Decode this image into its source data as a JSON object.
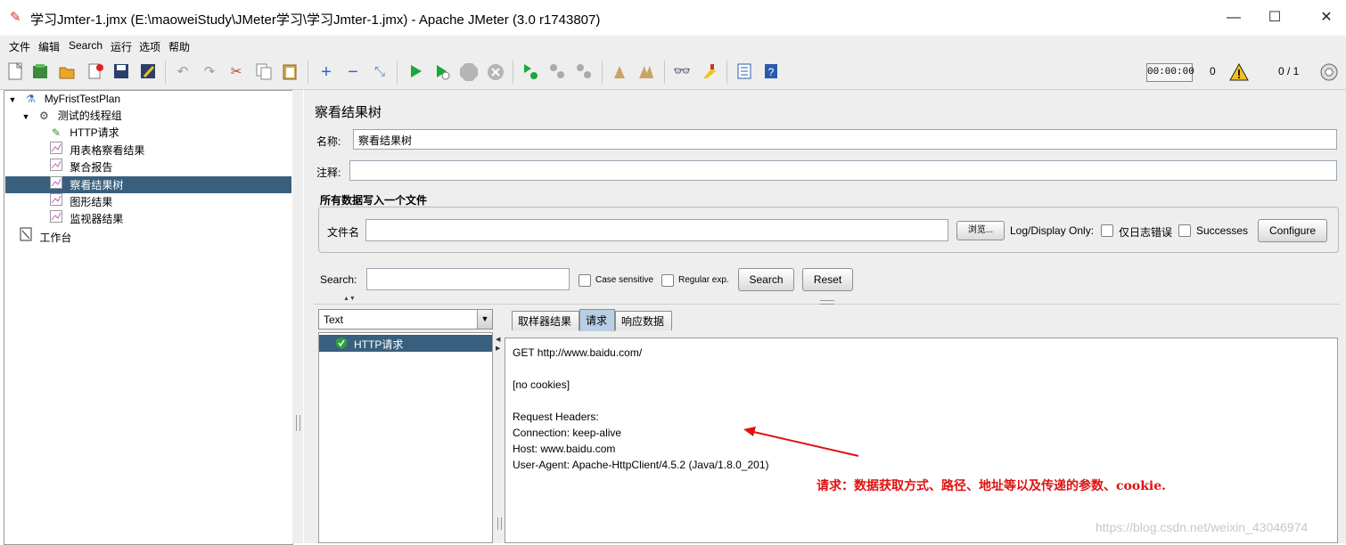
{
  "window": {
    "title": "学习Jmter-1.jmx (E:\\maoweiStudy\\JMeter学习\\学习Jmter-1.jmx) - Apache JMeter (3.0 r1743807)",
    "minimize": "—",
    "maximize": "☐",
    "close": "✕"
  },
  "menu": [
    "文件",
    "编辑",
    "Search",
    "运行",
    "选项",
    "帮助"
  ],
  "toolbar": {
    "timer": "00:00:00",
    "error_count": "0",
    "thread_ratio": "0 / 1"
  },
  "tree": {
    "nodes": [
      {
        "label": "MyFristTestPlan",
        "icon": "flask-icon",
        "toggle": "▼"
      },
      {
        "label": "测试的线程组",
        "icon": "gear-icon",
        "toggle": "▼"
      },
      {
        "label": "HTTP请求",
        "icon": "pipette-icon"
      },
      {
        "label": "用表格察看结果",
        "icon": "graph-icon"
      },
      {
        "label": "聚合报告",
        "icon": "graph-icon"
      },
      {
        "label": "察看结果树",
        "icon": "graph-icon"
      },
      {
        "label": "图形结果",
        "icon": "graph-icon"
      },
      {
        "label": "监视器结果",
        "icon": "graph-icon"
      },
      {
        "label": "工作台",
        "icon": "workbench-icon"
      }
    ]
  },
  "panel": {
    "heading": "察看结果树",
    "name_label": "名称:",
    "name_value": "察看结果树",
    "comment_label": "注释:",
    "comment_value": "",
    "file_group_title": "所有数据写入一个文件",
    "filename_label": "文件名",
    "browse_button": "浏览...",
    "log_display_label": "Log/Display Only:",
    "errors_only_label": "仅日志错误",
    "successes_label": "Successes",
    "configure_button": "Configure",
    "search_label": "Search:",
    "case_sensitive_label": "Case sensitive",
    "regex_label": "Regular exp.",
    "search_button": "Search",
    "reset_button": "Reset",
    "renderer_value": "Text",
    "results": [
      {
        "label": "HTTP请求",
        "status": "success"
      }
    ],
    "tabs": [
      {
        "label": "取样器结果",
        "active": false
      },
      {
        "label": "请求",
        "active": true
      },
      {
        "label": "响应数据",
        "active": false
      }
    ],
    "request_lines": [
      "GET http://www.baidu.com/",
      "",
      "[no cookies]",
      "",
      "Request Headers:",
      "Connection: keep-alive",
      "Host: www.baidu.com",
      "User-Agent: Apache-HttpClient/4.5.2 (Java/1.8.0_201)"
    ]
  },
  "annotation": {
    "text": "请求：数据获取方式、路径、地址等以及传递的参数、cookie."
  },
  "watermark": "https://blog.csdn.net/weixin_43046974",
  "colors": {
    "selection": "#38607e",
    "active_tab": "#b8cfe5",
    "annotation_red": "#e01010",
    "success_green": "#2e9e3e"
  }
}
